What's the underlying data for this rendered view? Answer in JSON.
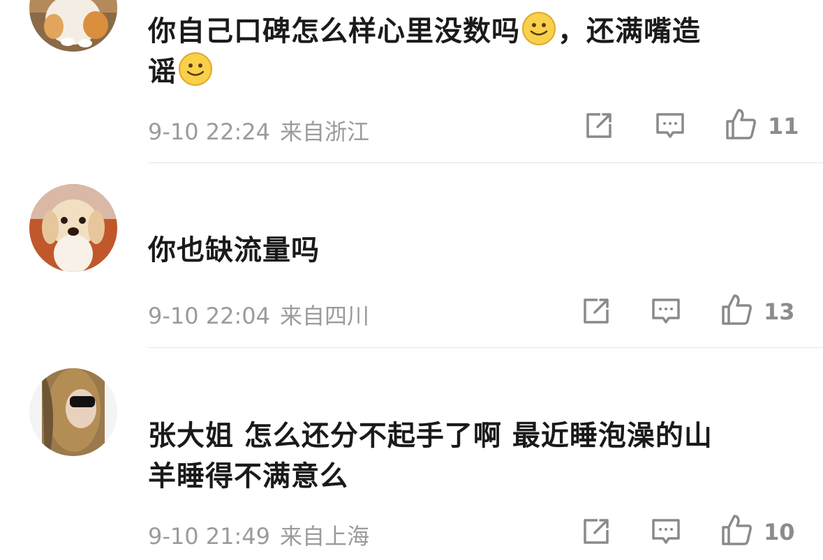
{
  "comments": [
    {
      "username": "",
      "text_line1": "你自己口碑怎么样心里没数吗",
      "text_mid": "，还满嘴造",
      "text_line2": "谣",
      "time": "9-10 22:24",
      "location": "来自浙江",
      "likes": "11",
      "avatar": "corgi-dog"
    },
    {
      "username": "",
      "text_line1": "你也缺流量吗",
      "time": "9-10 22:04",
      "location": "来自四川",
      "likes": "13",
      "avatar": "golden-retriever-puppy"
    },
    {
      "username": "",
      "text_line1": "张大姐 怎么还分不起手了啊 最近睡泡澡的山",
      "text_line2": "羊睡得不满意么",
      "time": "9-10 21:49",
      "location": "来自上海",
      "likes": "10",
      "avatar": "woman-with-sunglasses"
    }
  ],
  "icons": {
    "share": "share-icon",
    "comment": "comment-icon",
    "like": "thumbs-up-icon",
    "emoji": "smile-emoji-icon"
  },
  "colors": {
    "text": "#1a1a1a",
    "meta": "#9b9b9b",
    "divider": "#e5e5e5",
    "emoji": "#f7c531"
  }
}
